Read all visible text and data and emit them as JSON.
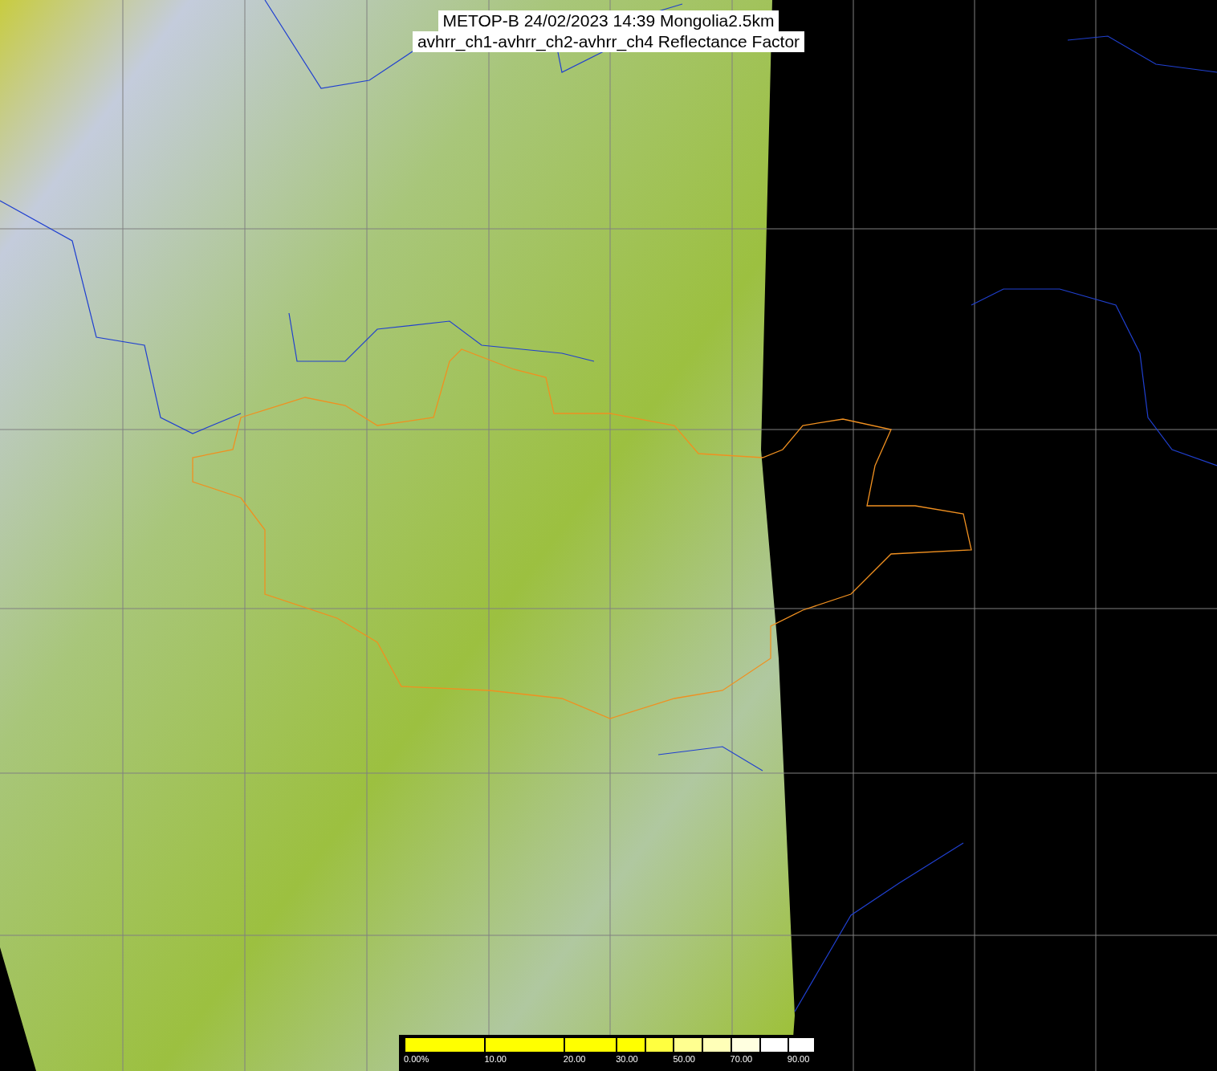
{
  "title": {
    "lines": [
      "METOP-B 24/02/2023 14:39 Mongolia2.5km",
      "avhrr_ch1-avhrr_ch2-avhrr_ch4 Reflectance Factor"
    ]
  },
  "colorbar": {
    "segments": [
      {
        "color": "#ffff00",
        "label": "0.00%"
      },
      {
        "color": "#ffff00",
        "label": "10.00"
      },
      {
        "color": "#ffff00",
        "label": "20.00"
      },
      {
        "color": "#ffff00",
        "label": "30.00"
      },
      {
        "color": "#ffff40"
      },
      {
        "color": "#ffff90",
        "label": "50.00"
      },
      {
        "color": "#ffffb8"
      },
      {
        "color": "#ffffe0",
        "label": "70.00"
      },
      {
        "color": "#ffffff"
      },
      {
        "color": "#ffffff",
        "label": "90.00"
      }
    ]
  }
}
